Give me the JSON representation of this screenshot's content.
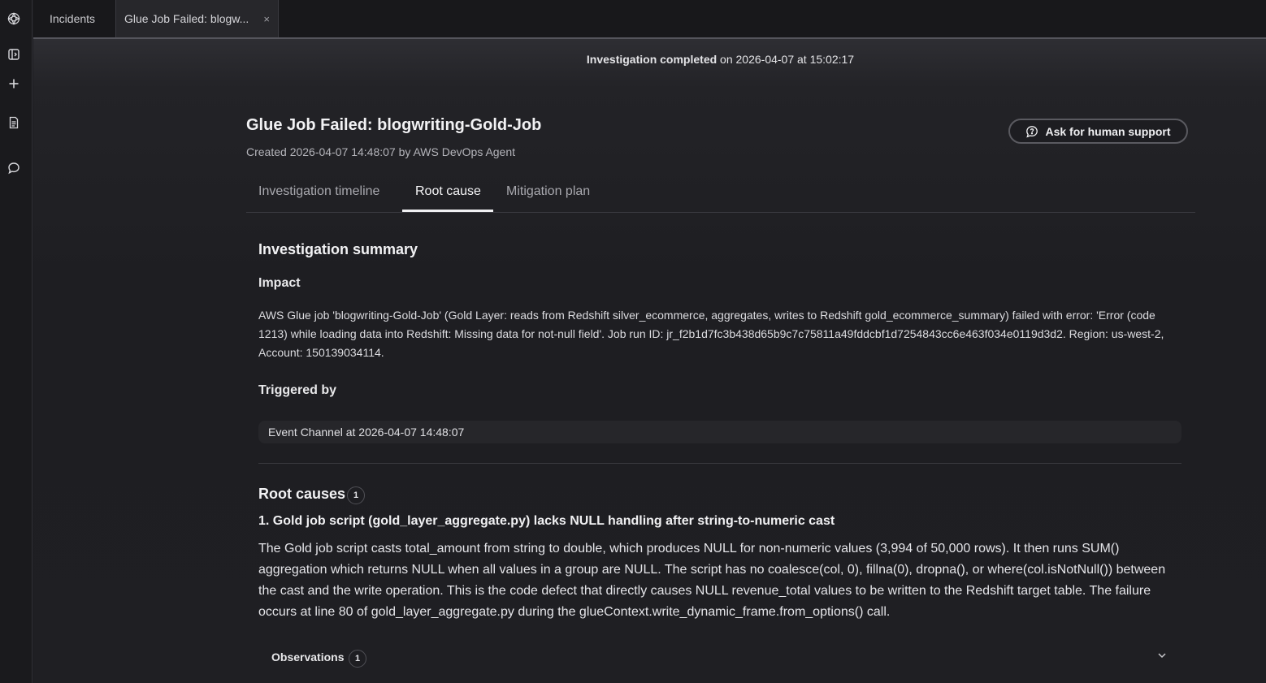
{
  "tabs": {
    "incidents_label": "Incidents",
    "active_label": "Glue Job Failed: blogw...",
    "close_glyph": "×"
  },
  "rail": {
    "icons": [
      "logo-icon",
      "panel-toggle-icon",
      "plus-icon",
      "document-icon",
      "chat-icon"
    ]
  },
  "status": {
    "bold": "Investigation completed",
    "rest": " on 2026-04-07 at 15:02:17"
  },
  "header": {
    "title": "Glue Job Failed: blogwriting-Gold-Job",
    "subtitle": "Created 2026-04-07 14:48:07 by AWS DevOps Agent",
    "support_button": "Ask for human support"
  },
  "content_tabs": {
    "timeline": "Investigation timeline",
    "root_cause": "Root cause",
    "mitigation": "Mitigation plan",
    "active": "Root cause"
  },
  "summary": {
    "heading": "Investigation summary",
    "impact_heading": "Impact",
    "impact_text": "AWS Glue job 'blogwriting-Gold-Job' (Gold Layer: reads from Redshift silver_ecommerce, aggregates, writes to Redshift gold_ecommerce_summary) failed with error: 'Error (code 1213) while loading data into Redshift: Missing data for not-null field'. Job run ID: jr_f2b1d7fc3b438d65b9c7c75811a49fddcbf1d7254843cc6e463f034e0119d3d2. Region: us-west-2, Account: 150139034114.",
    "triggered_heading": "Triggered by",
    "triggered_text": "Event Channel at 2026-04-07 14:48:07"
  },
  "root_causes": {
    "heading": "Root causes",
    "count": "1",
    "item_title": "1. Gold job script (gold_layer_aggregate.py) lacks NULL handling after string-to-numeric cast",
    "item_body": "The Gold job script casts total_amount from string to double, which produces NULL for non-numeric values (3,994 of 50,000 rows). It then runs SUM() aggregation which returns NULL when all values in a group are NULL. The script has no coalesce(col, 0), fillna(0), dropna(), or where(col.isNotNull()) between the cast and the write operation. This is the code defect that directly causes NULL revenue_total values to be written to the Redshift target table. The failure occurs at line 80 of gold_layer_aggregate.py during the glueContext.write_dynamic_frame.from_options() call.",
    "observations_label": "Observations",
    "observations_count": "1"
  }
}
